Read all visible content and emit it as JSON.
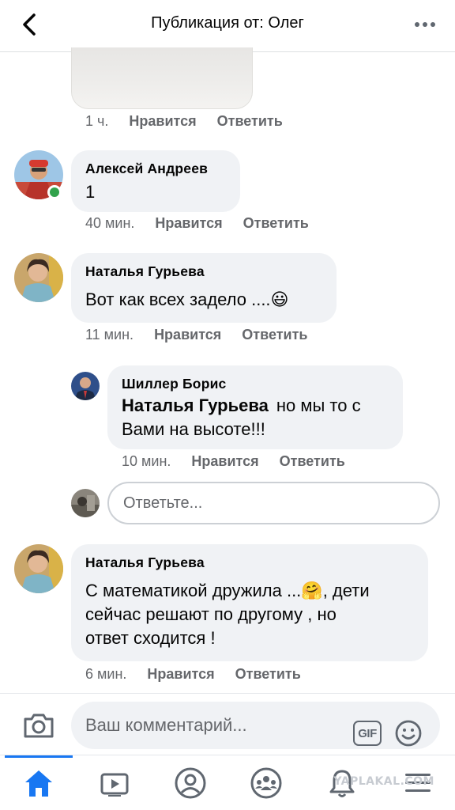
{
  "header": {
    "title": "Публикация от: Олег"
  },
  "comments": [
    {
      "meta": {
        "time": "1 ч.",
        "like": "Нравится",
        "reply": "Ответить"
      }
    },
    {
      "author": "Алексей Андреев",
      "text": "1",
      "online": true,
      "meta": {
        "time": "40 мин.",
        "like": "Нравится",
        "reply": "Ответить"
      }
    },
    {
      "author": "Наталья Гурьева",
      "text": "Вот как всех задело ....",
      "emoji": "😃",
      "meta": {
        "time": "11 мин.",
        "like": "Нравится",
        "reply": "Ответить"
      }
    },
    {
      "author": "Шиллер Борис",
      "mention": "Наталья Гурьева",
      "text_line1": "но мы то с",
      "text_line2": "Вами на высоте!!!",
      "meta": {
        "time": "10 мин.",
        "like": "Нравится",
        "reply": "Ответить"
      }
    },
    {
      "author": "Наталья Гурьева",
      "text_line1": "С математикой дружила ...",
      "emoji": "🤗",
      "text_line1b": ", дети",
      "text_line2": "сейчас решают по другому , но",
      "text_line3": "ответ сходится !",
      "meta": {
        "time": "6 мин.",
        "like": "Нравится",
        "reply": "Ответить"
      }
    }
  ],
  "reply_box": {
    "placeholder": "Ответьте..."
  },
  "composer": {
    "placeholder": "Ваш комментарий...",
    "gif_label": "GIF"
  },
  "tabs": [
    {
      "name": "home-icon",
      "active": true
    },
    {
      "name": "video-icon",
      "active": false
    },
    {
      "name": "profile-icon",
      "active": false
    },
    {
      "name": "groups-icon",
      "active": false
    },
    {
      "name": "notifications-icon",
      "active": false
    },
    {
      "name": "menu-icon",
      "active": false
    }
  ],
  "watermark": "YAPLAKAL.COM",
  "colors": {
    "accent": "#1877f2",
    "online": "#31a24c",
    "bubble": "#f0f2f5",
    "meta": "#65676b"
  }
}
